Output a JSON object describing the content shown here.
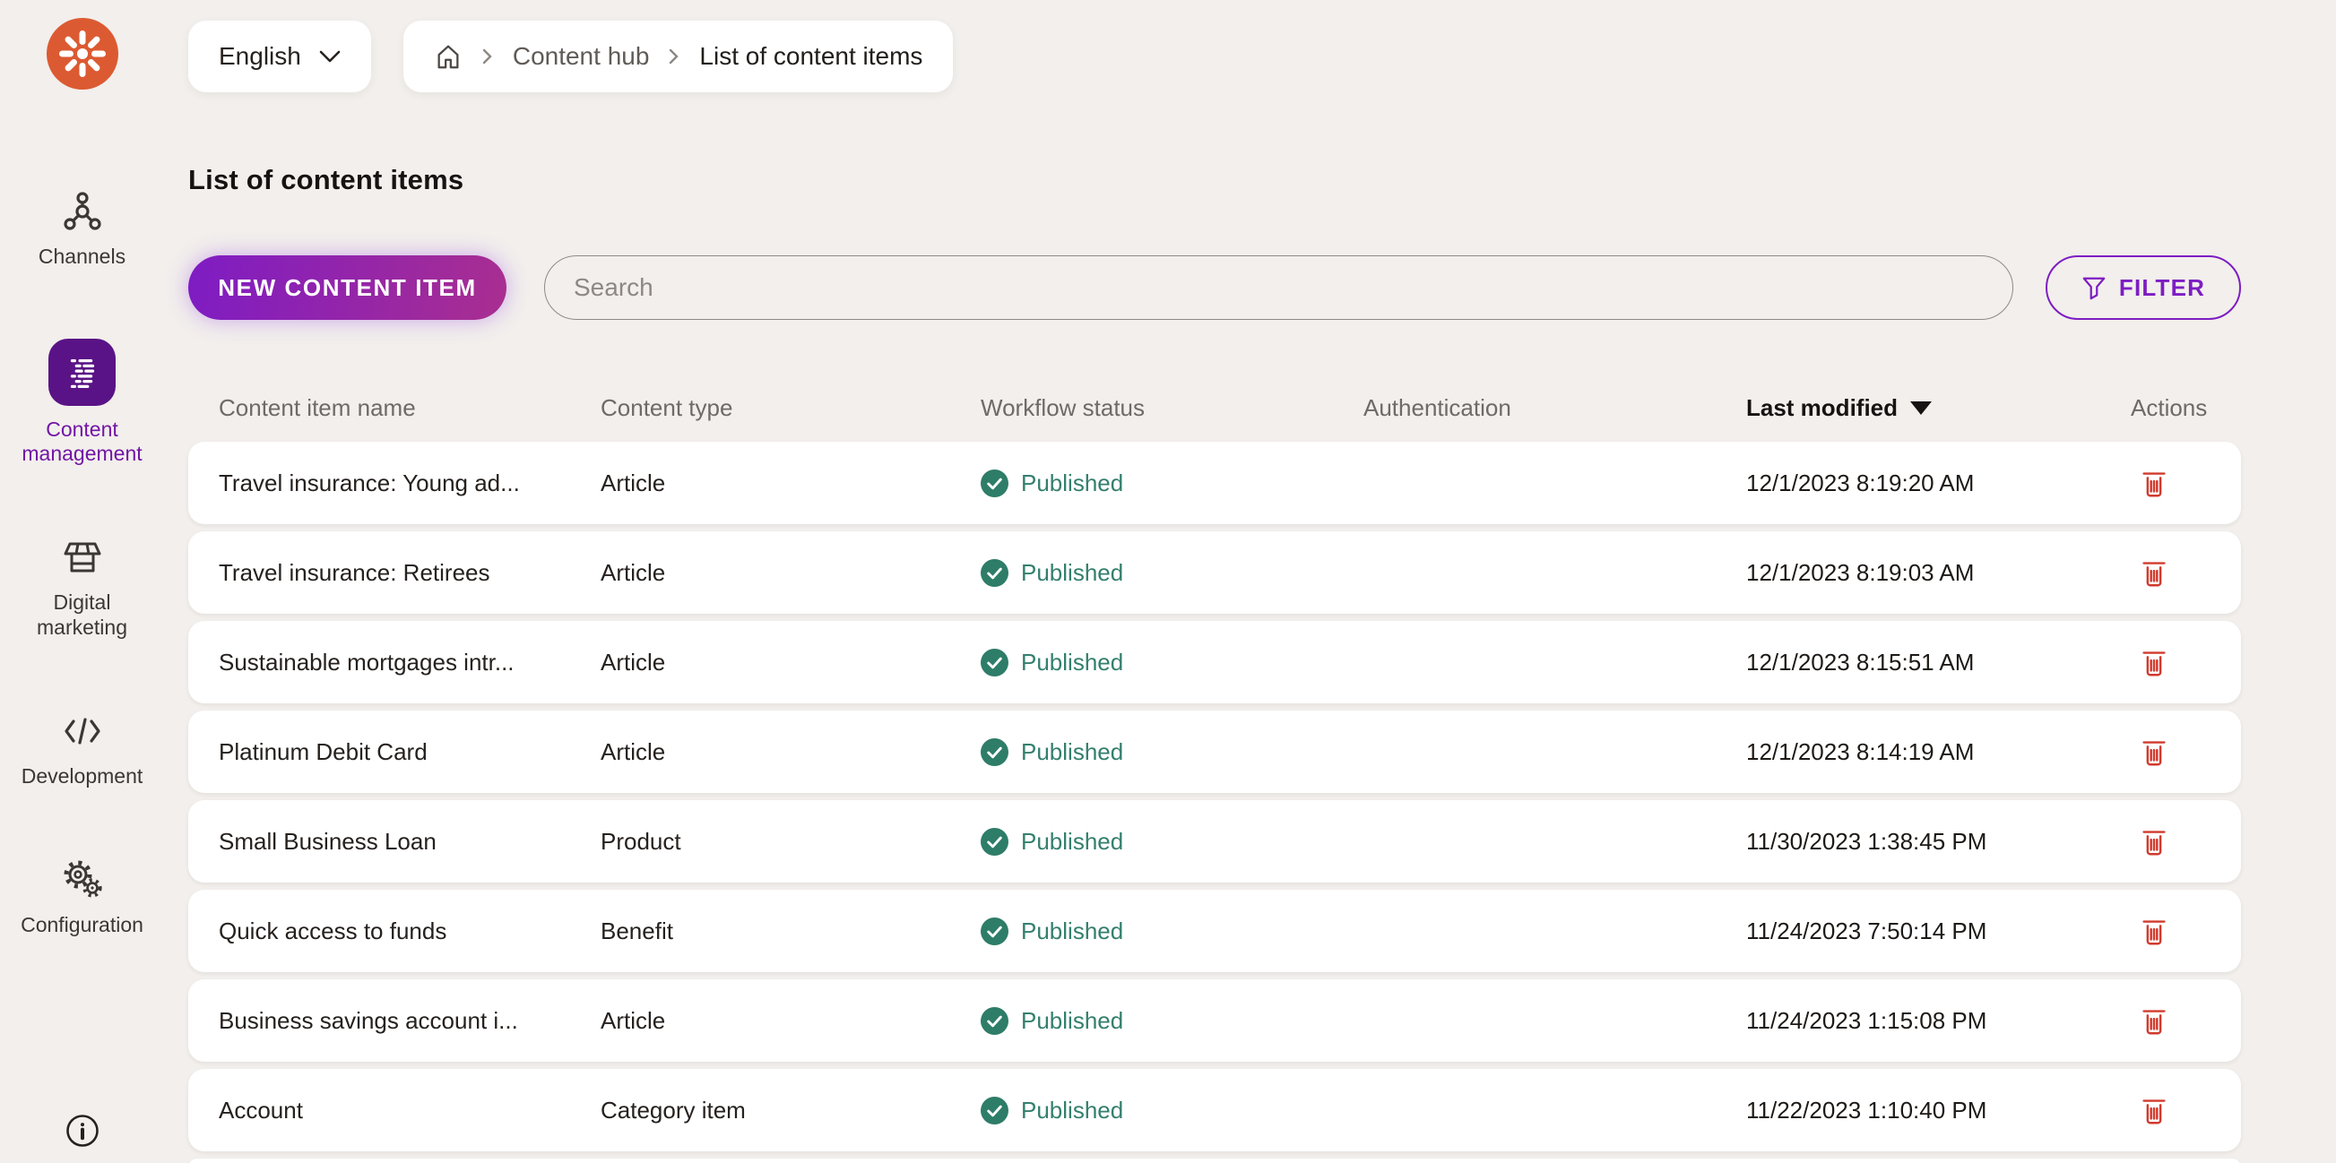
{
  "topbar": {
    "language": {
      "value": "English"
    },
    "breadcrumb": {
      "items": [
        "Content hub",
        "List of content items"
      ]
    }
  },
  "sidebar": {
    "items": [
      {
        "label": "Channels",
        "icon": "channels-icon",
        "active": false
      },
      {
        "label": "Content management",
        "icon": "content-management-icon",
        "active": true
      },
      {
        "label": "Digital marketing",
        "icon": "digital-marketing-icon",
        "active": false
      },
      {
        "label": "Development",
        "icon": "development-icon",
        "active": false
      },
      {
        "label": "Configuration",
        "icon": "configuration-icon",
        "active": false
      }
    ]
  },
  "page": {
    "title": "List of content items"
  },
  "controls": {
    "new_button_label": "NEW CONTENT ITEM",
    "search_placeholder": "Search",
    "search_value": "",
    "filter_label": "FILTER"
  },
  "table": {
    "columns": [
      "Content item name",
      "Content type",
      "Workflow status",
      "Authentication",
      "Last modified",
      "Actions"
    ],
    "sorted_column": "Last modified",
    "sort_direction": "descending",
    "rows": [
      {
        "name": "Travel insurance: Young ad...",
        "type": "Article",
        "status": "Published",
        "authentication": "",
        "last_modified": "12/1/2023 8:19:20 AM"
      },
      {
        "name": "Travel insurance: Retirees",
        "type": "Article",
        "status": "Published",
        "authentication": "",
        "last_modified": "12/1/2023 8:19:03 AM"
      },
      {
        "name": "Sustainable mortgages intr...",
        "type": "Article",
        "status": "Published",
        "authentication": "",
        "last_modified": "12/1/2023 8:15:51 AM"
      },
      {
        "name": "Platinum Debit Card",
        "type": "Article",
        "status": "Published",
        "authentication": "",
        "last_modified": "12/1/2023 8:14:19 AM"
      },
      {
        "name": "Small Business Loan",
        "type": "Product",
        "status": "Published",
        "authentication": "",
        "last_modified": "11/30/2023 1:38:45 PM"
      },
      {
        "name": "Quick access to funds",
        "type": "Benefit",
        "status": "Published",
        "authentication": "",
        "last_modified": "11/24/2023 7:50:14 PM"
      },
      {
        "name": "Business savings account i...",
        "type": "Article",
        "status": "Published",
        "authentication": "",
        "last_modified": "11/24/2023 1:15:08 PM"
      },
      {
        "name": "Account",
        "type": "Category item",
        "status": "Published",
        "authentication": "",
        "last_modified": "11/22/2023 1:10:40 PM"
      }
    ]
  },
  "colors": {
    "background": "#f2efec",
    "brand_orange": "#dc5a32",
    "accent_purple": "#7d1dc2",
    "active_tile_purple": "#5a1386",
    "button_gradient_start": "#7e1cc4",
    "button_gradient_end": "#a92e90",
    "published_teal": "#2e7d68",
    "delete_red": "#d23a2d"
  }
}
